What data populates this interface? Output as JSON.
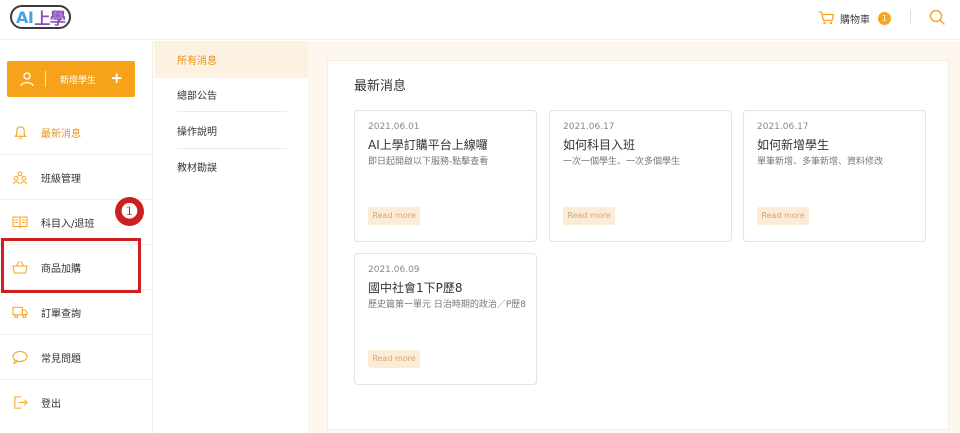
{
  "header": {
    "logo_latin": "AI",
    "logo_cn": "上學",
    "cart_label": "購物車",
    "cart_count": "1"
  },
  "sidebar": {
    "add_student_label": "新增學生",
    "add_plus": "+",
    "items": [
      {
        "label": "最新消息",
        "icon": "bell-icon",
        "active": true
      },
      {
        "label": "班級管理",
        "icon": "users-icon",
        "active": false
      },
      {
        "label": "科目入/退班",
        "icon": "book-icon",
        "active": false
      },
      {
        "label": "商品加購",
        "icon": "basket-icon",
        "active": false
      },
      {
        "label": "訂單查詢",
        "icon": "truck-icon",
        "active": false
      },
      {
        "label": "常見問題",
        "icon": "chat-icon",
        "active": false
      },
      {
        "label": "登出",
        "icon": "logout-icon",
        "active": false
      }
    ],
    "step_badge": "❶"
  },
  "submenu": {
    "items": [
      {
        "label": "所有消息",
        "active": true
      },
      {
        "label": "總部公告",
        "active": false
      },
      {
        "label": "操作說明",
        "active": false
      },
      {
        "label": "教材勘誤",
        "active": false
      }
    ]
  },
  "main": {
    "title": "最新消息",
    "cards": [
      {
        "date": "2021.06.01",
        "title": "AI上學訂購平台上線囉",
        "desc": "即日起開啟以下服務-點擊查看",
        "more": "Read more"
      },
      {
        "date": "2021.06.17",
        "title": "如何科目入班",
        "desc": "一次一個學生、一次多個學生",
        "more": "Read more"
      },
      {
        "date": "2021.06.17",
        "title": "如何新增學生",
        "desc": "單筆新增、多筆新增、資料修改",
        "more": "Read more"
      },
      {
        "date": "2021.06.09",
        "title": "國中社會1下P歷8",
        "desc": "歷史篇第一單元 日治時期的政治／P歷8",
        "more": "Read more"
      }
    ]
  },
  "colors": {
    "accent": "#f7a21b",
    "active_text": "#e8901a",
    "highlight": "#cc1f1f"
  }
}
